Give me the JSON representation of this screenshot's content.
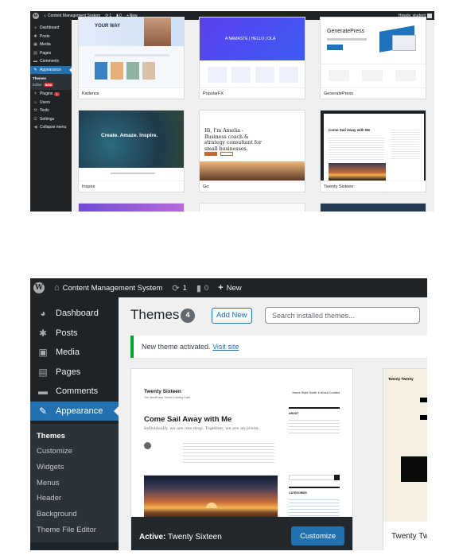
{
  "top": {
    "adminbar": {
      "site": "Content Management System",
      "updates": "1",
      "comments": "0",
      "new": "New",
      "howdy": "Howdy, student"
    },
    "sidebar": {
      "items": [
        {
          "label": "Dashboard",
          "icon": "dashboard-icon",
          "glyph": "◕"
        },
        {
          "label": "Posts",
          "icon": "pin-icon",
          "glyph": "✱"
        },
        {
          "label": "Media",
          "icon": "media-icon",
          "glyph": "▣"
        },
        {
          "label": "Pages",
          "icon": "pages-icon",
          "glyph": "▤"
        },
        {
          "label": "Comments",
          "icon": "comment-icon",
          "glyph": "▬"
        },
        {
          "label": "Appearance",
          "icon": "brush-icon",
          "glyph": "✎"
        }
      ],
      "sub": [
        "Themes",
        "Editor"
      ],
      "editor_badge": "beta",
      "items2": [
        {
          "label": "Plugins",
          "icon": "plugin-icon",
          "glyph": "⚘",
          "badge": "1"
        },
        {
          "label": "Users",
          "icon": "users-icon",
          "glyph": "☺"
        },
        {
          "label": "Tools",
          "icon": "tools-icon",
          "glyph": "⚒"
        },
        {
          "label": "Settings",
          "icon": "settings-icon",
          "glyph": "☰"
        },
        {
          "label": "Collapse menu",
          "icon": "collapse-icon",
          "glyph": "◀"
        }
      ]
    },
    "themes": [
      {
        "name": "Kadence",
        "hero": "YOUR WAY"
      },
      {
        "name": "PopularFX",
        "hero": "A NAMASTE | HELLO | OLÁ"
      },
      {
        "name": "GeneratePress",
        "hero": "GeneratePress"
      },
      {
        "name": "Inspire",
        "hero": "Create. Amaze. Inspire."
      },
      {
        "name": "Go",
        "hero": "Hi, I'm Amelia - Business coach & strategy consultant for small businesses."
      },
      {
        "name": "Twenty Sixteen",
        "hero": "Come Sail Away with Me"
      }
    ]
  },
  "bottom": {
    "adminbar": {
      "site": "Content Management System",
      "updates": "1",
      "comments": "0",
      "new": "New"
    },
    "sidebar": {
      "items": [
        {
          "label": "Dashboard",
          "icon": "dashboard-icon",
          "glyph": "◕"
        },
        {
          "label": "Posts",
          "icon": "pin-icon",
          "glyph": "✱"
        },
        {
          "label": "Media",
          "icon": "media-icon",
          "glyph": "▣"
        },
        {
          "label": "Pages",
          "icon": "pages-icon",
          "glyph": "▤"
        },
        {
          "label": "Comments",
          "icon": "comment-icon",
          "glyph": "▬"
        },
        {
          "label": "Appearance",
          "icon": "brush-icon",
          "glyph": "✎"
        }
      ],
      "sub": [
        "Themes",
        "Customize",
        "Widgets",
        "Menus",
        "Header",
        "Background",
        "Theme File Editor"
      ]
    },
    "page_title": "Themes",
    "theme_count": "4",
    "add_new": "Add New",
    "search_placeholder": "Search installed themes...",
    "notice": {
      "text": "New theme activated.",
      "link": "Visit site"
    },
    "active_theme": {
      "prefix": "Active:",
      "name": "Twenty Sixteen",
      "customize": "Customize",
      "preview": {
        "site_title": "Twenty Sixteen",
        "tagline": "The WordPress Theme Gaming Suite",
        "nav": "Home   Style Guide ∨   About   Contact",
        "post_title": "Come Sail Away with Me",
        "excerpt": "Individually, we are one drop. Together, we are an ocean.",
        "widget_about": "ABOUT",
        "widget_categories": "CATEGORIES"
      }
    },
    "next_theme": {
      "name": "Twenty Twenty",
      "header": "Twenty Twenty"
    }
  },
  "colors": {
    "admin_dark": "#1d2327",
    "accent_blue": "#2271b1",
    "success_green": "#00a32a",
    "badge_red": "#d63638"
  }
}
